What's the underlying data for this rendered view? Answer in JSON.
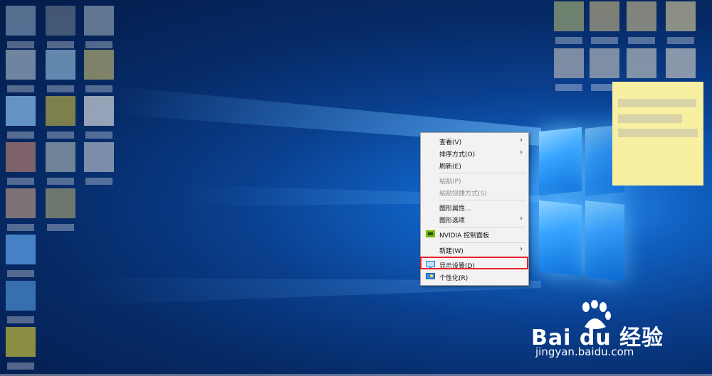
{
  "context_menu": {
    "items": [
      {
        "label": "查看(V)",
        "has_submenu": true,
        "disabled": false
      },
      {
        "label": "排序方式(O)",
        "has_submenu": true,
        "disabled": false
      },
      {
        "label": "刷新(E)",
        "has_submenu": false,
        "disabled": false
      },
      {
        "label": "粘贴(P)",
        "has_submenu": false,
        "disabled": true
      },
      {
        "label": "粘贴快捷方式(S)",
        "has_submenu": false,
        "disabled": true
      },
      {
        "label": "图形属性...",
        "has_submenu": false,
        "disabled": false
      },
      {
        "label": "图形选项",
        "has_submenu": true,
        "disabled": false
      },
      {
        "label": "NVIDIA 控制面板",
        "has_submenu": false,
        "disabled": false,
        "icon": "nvidia-icon"
      },
      {
        "label": "新建(W)",
        "has_submenu": true,
        "disabled": false
      },
      {
        "label": "显示设置(D)",
        "has_submenu": false,
        "disabled": false,
        "icon": "display-icon",
        "highlighted": true
      },
      {
        "label": "个性化(R)",
        "has_submenu": false,
        "disabled": false,
        "icon": "personalize-icon"
      }
    ],
    "submenu_glyph": "›"
  },
  "watermark": {
    "brand": "Bai du 经验",
    "url": "jingyan.baidu.com"
  },
  "colors": {
    "highlight_border": "#e8202a",
    "sticky_note": "#f6f0a0",
    "desktop_accent": "#2f8ff0"
  }
}
